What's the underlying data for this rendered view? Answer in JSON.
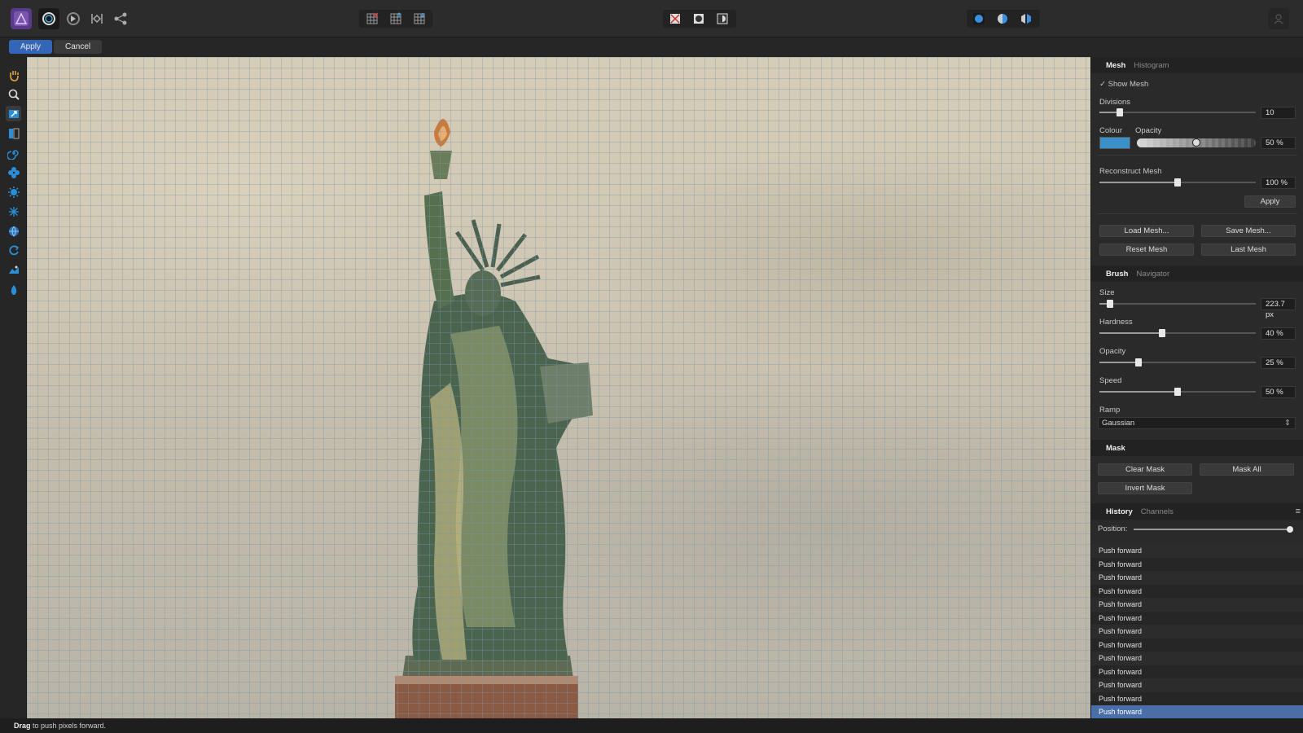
{
  "toolbar": {
    "personas": [
      "affinity-photo-icon",
      "liquify-persona-icon",
      "develop-persona-icon",
      "tone-mapping-icon",
      "export-persona-icon"
    ],
    "center_left": [
      "mesh-freeze-icon",
      "mesh-thaw-icon",
      "mesh-grid-icon"
    ],
    "center": [
      "clear-mask-icon",
      "quick-mask-icon",
      "mask-toggle-icon"
    ],
    "right": [
      "view-mode-icon",
      "split-view-icon",
      "mirror-view-icon"
    ],
    "user_icon": "user-icon"
  },
  "context": {
    "apply_label": "Apply",
    "cancel_label": "Cancel"
  },
  "tools": [
    "hand-icon",
    "zoom-icon",
    "push-forward-icon",
    "push-left-icon",
    "twirl-icon",
    "pinch-icon",
    "punch-icon",
    "turbulence-icon",
    "freeze-icon",
    "thaw-icon",
    "reconstruct-icon",
    "clone-icon"
  ],
  "mesh_panel": {
    "tabs": [
      "Mesh",
      "Histogram"
    ],
    "show_mesh_label": "Show Mesh",
    "show_mesh_checked": true,
    "divisions_label": "Divisions",
    "divisions_value": "10",
    "divisions_level": 0.13,
    "colour_label": "Colour",
    "colour": "#3a90c8",
    "opacity_label": "Opacity",
    "opacity_value": "50 %",
    "opacity_level": 0.5,
    "reconstruct_label": "Reconstruct Mesh",
    "reconstruct_value": "100 %",
    "reconstruct_level": 0.5,
    "apply_label": "Apply",
    "load_mesh": "Load Mesh...",
    "save_mesh": "Save Mesh...",
    "reset_mesh": "Reset Mesh",
    "last_mesh": "Last Mesh"
  },
  "brush_panel": {
    "tabs": [
      "Brush",
      "Navigator"
    ],
    "size_label": "Size",
    "size_value": "223.7 px",
    "size_level": 0.07,
    "hardness_label": "Hardness",
    "hardness_value": "40 %",
    "hardness_level": 0.4,
    "opacity_label": "Opacity",
    "opacity_value": "25 %",
    "opacity_level": 0.25,
    "speed_label": "Speed",
    "speed_value": "50 %",
    "speed_level": 0.5,
    "ramp_label": "Ramp",
    "ramp_value": "Gaussian"
  },
  "mask_panel": {
    "title": "Mask",
    "clear_mask": "Clear Mask",
    "mask_all": "Mask All",
    "invert_mask": "Invert Mask"
  },
  "history_panel": {
    "tabs": [
      "History",
      "Channels"
    ],
    "position_label": "Position:",
    "position_level": 1.0,
    "items": [
      "Push forward",
      "Push forward",
      "Push forward",
      "Push forward",
      "Push forward",
      "Push forward",
      "Push forward",
      "Push forward",
      "Push forward",
      "Push forward",
      "Push forward",
      "Push forward",
      "Push forward"
    ],
    "selected_index": 12
  },
  "status": {
    "bold": "Drag",
    "text": " to push pixels forward."
  }
}
